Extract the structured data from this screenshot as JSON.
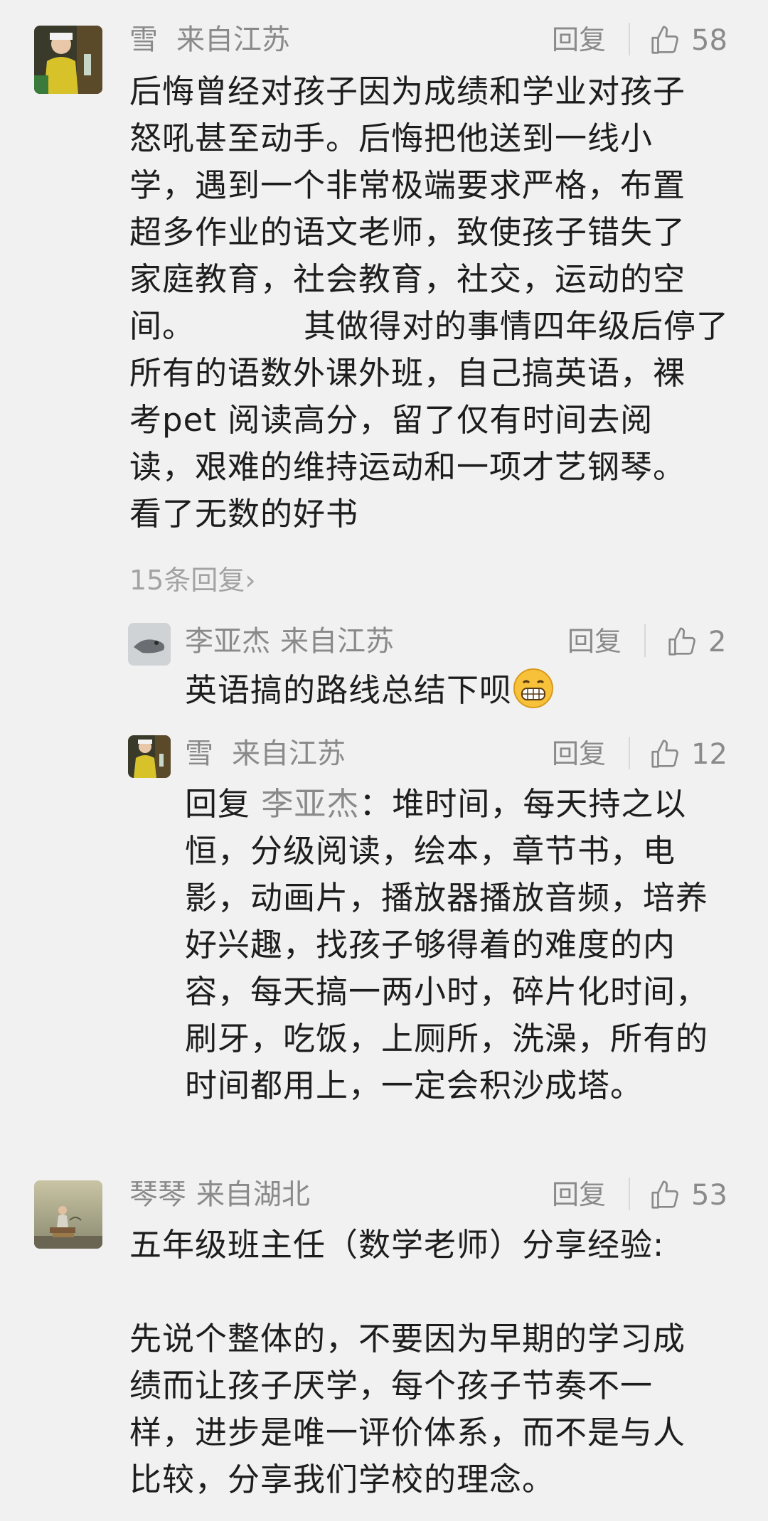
{
  "comments": [
    {
      "user": "雪",
      "location": "来自江苏",
      "reply_label": "回复",
      "likes": "58",
      "lines": [
        "后悔曾经对孩子因为成绩和学业对孩子",
        "怒吼甚至动手。后悔把他送到一线小",
        "学，遇到一个非常极端要求严格，布置",
        "超多作业的语文老师，致使孩子错失了",
        "家庭教育，社会教育，社交，运动的空",
        "间。          其做得对的事情四年级后停了",
        "所有的语数外课外班，自己搞英语，裸",
        "考pet 阅读高分，留了仅有时间去阅",
        "读，艰难的维持运动和一项才艺钢琴。",
        "看了无数的好书"
      ],
      "more_replies": "15条回复",
      "more_replies_arrow": "›",
      "replies": [
        {
          "user": "李亚杰",
          "location": "来自江苏",
          "reply_label": "回复",
          "likes": "2",
          "text": "英语搞的路线总结下呗",
          "emoji": "grin-emoji"
        },
        {
          "user": "雪",
          "location": "来自江苏",
          "reply_label": "回复",
          "likes": "12",
          "reply_prefix": "回复 ",
          "mention": "李亚杰",
          "mention_suffix": "：堆时间，每天持之以",
          "lines": [
            "恒，分级阅读，绘本，章节书，电",
            "影，动画片，播放器播放音频，培养",
            "好兴趣，找孩子够得着的难度的内",
            "容，每天搞一两小时，碎片化时间，",
            "刷牙，吃饭，上厕所，洗澡，所有的",
            "时间都用上，一定会积沙成塔。"
          ]
        }
      ]
    },
    {
      "user": "琴琴",
      "location": "来自湖北",
      "reply_label": "回复",
      "likes": "53",
      "lines": [
        "五年级班主任（数学老师）分享经验:",
        "",
        "先说个整体的，不要因为早期的学习成",
        "绩而让孩子厌学，每个孩子节奏不一",
        "样，进步是唯一评价体系，而不是与人",
        "比较，分享我们学校的理念。"
      ]
    }
  ],
  "colors": {
    "background": "#f1f1f1",
    "meta_text": "#8a8a8a",
    "body_text": "#1d1d1d",
    "more_replies": "#a3a3a3"
  }
}
